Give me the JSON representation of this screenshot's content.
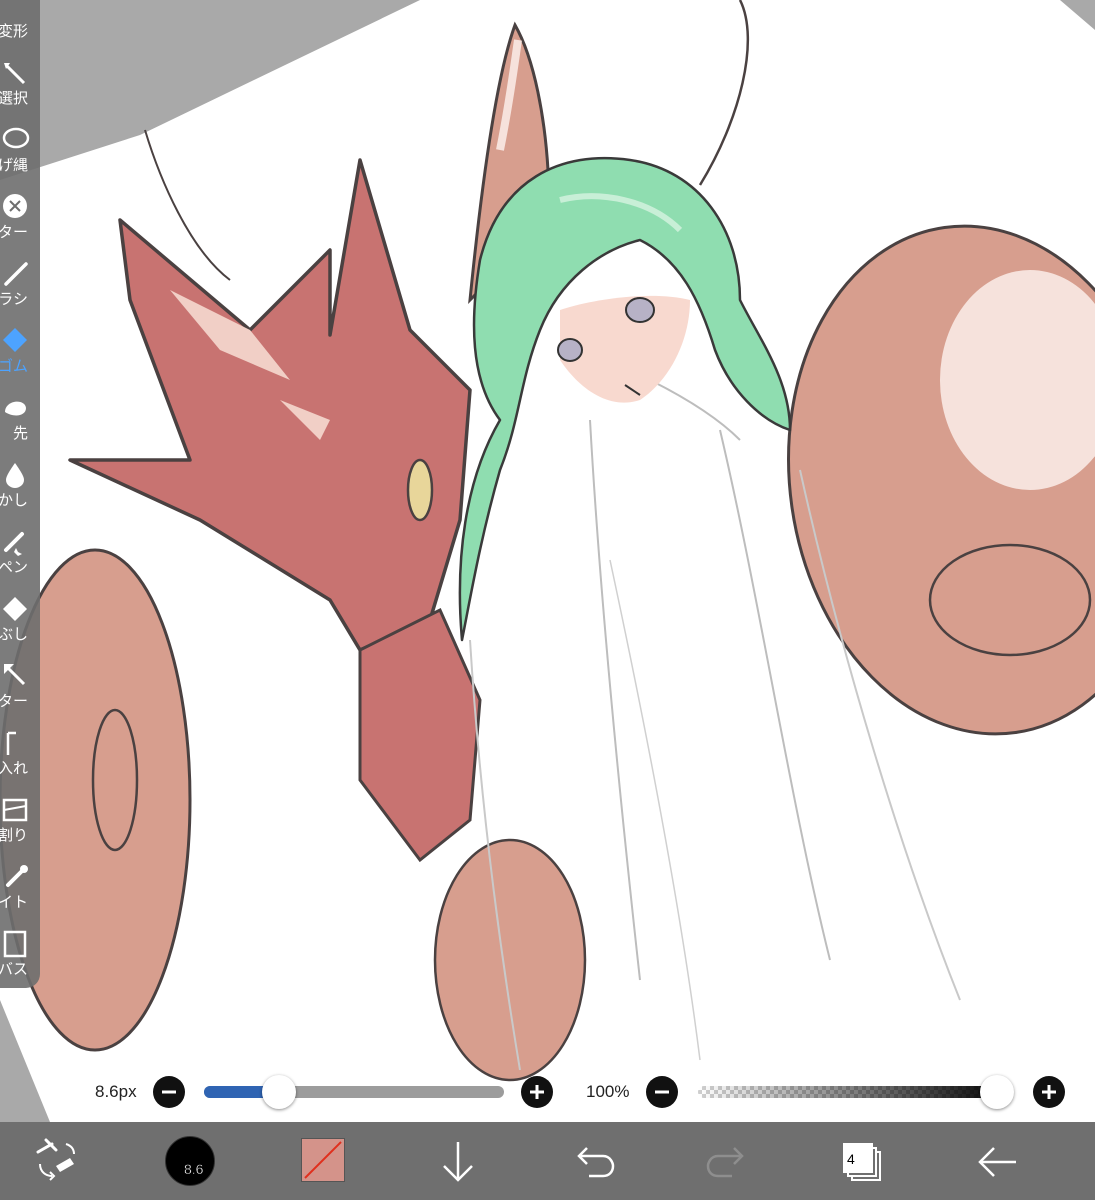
{
  "tools": [
    {
      "id": "transform",
      "label": "変形",
      "icon": "transform-icon"
    },
    {
      "id": "select",
      "label": "選択",
      "icon": "select-icon"
    },
    {
      "id": "lasso",
      "label": "げ縄",
      "icon": "lasso-icon"
    },
    {
      "id": "filter",
      "label": "ンター",
      "icon": "filter-icon"
    },
    {
      "id": "brush",
      "label": "ラシ",
      "icon": "brush-icon"
    },
    {
      "id": "eraser",
      "label": "ゴム",
      "icon": "eraser-icon",
      "active": true
    },
    {
      "id": "smudge",
      "label": "先",
      "icon": "smudge-icon"
    },
    {
      "id": "blur",
      "label": "かし",
      "icon": "blur-icon"
    },
    {
      "id": "special-pen",
      "label": "ペン",
      "icon": "special-pen-icon"
    },
    {
      "id": "fill",
      "label": "りつぶし",
      "icon": "fill-icon"
    },
    {
      "id": "text",
      "label": "ター",
      "icon": "text-cursor-icon"
    },
    {
      "id": "text-insert",
      "label": "入れ",
      "icon": "text-insert-icon"
    },
    {
      "id": "frame-divide",
      "label": "割り",
      "icon": "frame-divide-icon"
    },
    {
      "id": "eyedropper",
      "label": "イト",
      "icon": "eyedropper-icon"
    },
    {
      "id": "canvas",
      "label": "ンバス",
      "icon": "canvas-icon"
    }
  ],
  "slider_bar": {
    "brush_size_label": "8.6px",
    "brush_size_fraction": 0.19,
    "opacity_label": "100%",
    "opacity_fraction": 1.0
  },
  "bottom_bar": {
    "brush_size_display": "8.6",
    "current_color": "#d4938a",
    "layer_count": "4"
  },
  "colors": {
    "accent": "#4da3ff",
    "panel": "#6e6e6e",
    "toolbar": "#6f6f6f",
    "track_fill": "#2f64b3"
  }
}
